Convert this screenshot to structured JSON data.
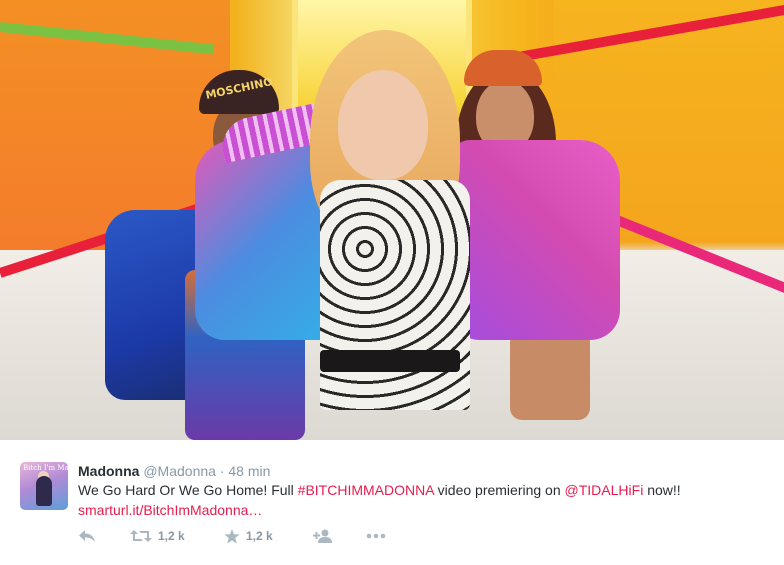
{
  "tweet": {
    "name": "Madonna",
    "handle": "@Madonna",
    "separator": "·",
    "time": "48 min",
    "text_part1": "We Go Hard Or We Go Home! Full ",
    "hashtag": "#BITCHIMMADONNA",
    "text_part2": " video premiering on ",
    "mention": "@TIDALHiFi",
    "text_part3": " now!!",
    "url": "smarturl.it/BitchImMadonna…",
    "avatar_text": "Bitch I'm Madonna"
  },
  "actions": {
    "retweet_count": "1,2 k",
    "like_count": "1,2 k"
  },
  "photo": {
    "cap_text": "MOSCHINO"
  },
  "colors": {
    "link": "#e81c4f",
    "muted": "#8899a6",
    "icon": "#aab8c2",
    "text": "#292f33"
  }
}
